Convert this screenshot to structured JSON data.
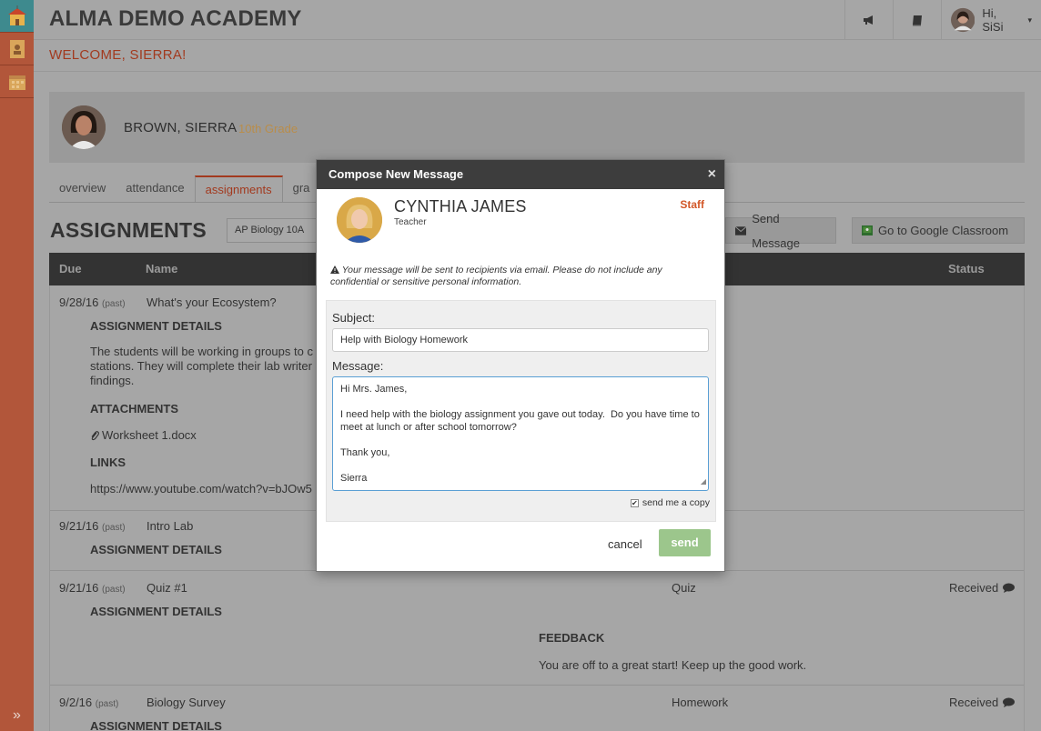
{
  "app": {
    "title": "ALMA DEMO ACADEMY",
    "welcome": "WELCOME, SIERRA!"
  },
  "user_menu": {
    "greeting": "Hi, SiSi",
    "caret": "▾"
  },
  "rail": {
    "expand_icon": "»"
  },
  "student": {
    "name": "BROWN, SIERRA",
    "grade": "10th Grade"
  },
  "tabs": [
    {
      "label": "overview"
    },
    {
      "label": "attendance"
    },
    {
      "label": "assignments"
    },
    {
      "label": "gra"
    }
  ],
  "assignments": {
    "title": "ASSIGNMENTS",
    "course": "AP Biology 10A",
    "send_message_label": "Send Message",
    "google_label": "Go to Google Classroom",
    "columns": {
      "due": "Due",
      "name": "Name",
      "status": "Status"
    },
    "rows": [
      {
        "due": "9/28/16",
        "past": "(past)",
        "name": "What's your Ecosystem?",
        "details_label": "ASSIGNMENT DETAILS",
        "details_text": "The students will be working in groups to c stations. They will complete their lab writer findings.",
        "attachments_label": "ATTACHMENTS",
        "attachment": "Worksheet 1.docx",
        "links_label": "LINKS",
        "link": "https://www.youtube.com/watch?v=bJOw5"
      },
      {
        "due": "9/21/16",
        "past": "(past)",
        "name": "Intro Lab",
        "details_label": "ASSIGNMENT DETAILS"
      },
      {
        "due": "9/21/16",
        "past": "(past)",
        "name": "Quiz #1",
        "details_label": "ASSIGNMENT DETAILS",
        "type": "Quiz",
        "status": "Received",
        "feedback_label": "FEEDBACK",
        "feedback": "You are off to a great start! Keep up the good work."
      },
      {
        "due": "9/2/16",
        "past": "(past)",
        "name": "Biology Survey",
        "details_label": "ASSIGNMENT DETAILS",
        "type": "Homework",
        "status": "Received"
      }
    ]
  },
  "modal": {
    "title": "Compose New Message",
    "close": "×",
    "recipient": {
      "name": "CYNTHIA JAMES",
      "role": "Teacher",
      "badge": "Staff"
    },
    "notice": "Your message will be sent to recipients via email. Please do not include any confidential or sensitive personal information.",
    "subject_label": "Subject:",
    "subject_value": "Help with Biology Homework",
    "message_label": "Message:",
    "message_value": "Hi Mrs. James,\n\nI need help with the biology assignment you gave out today.  Do you have time to meet at lunch or after school tomorrow?\n\nThank you,\n\nSierra",
    "copy_label": "send me a copy",
    "copy_checked": "✔",
    "cancel_label": "cancel",
    "send_label": "send"
  },
  "colors": {
    "accent": "#d25728",
    "send": "#9cc68c",
    "header": "#3d3d3d",
    "rail": "#b2563a"
  }
}
